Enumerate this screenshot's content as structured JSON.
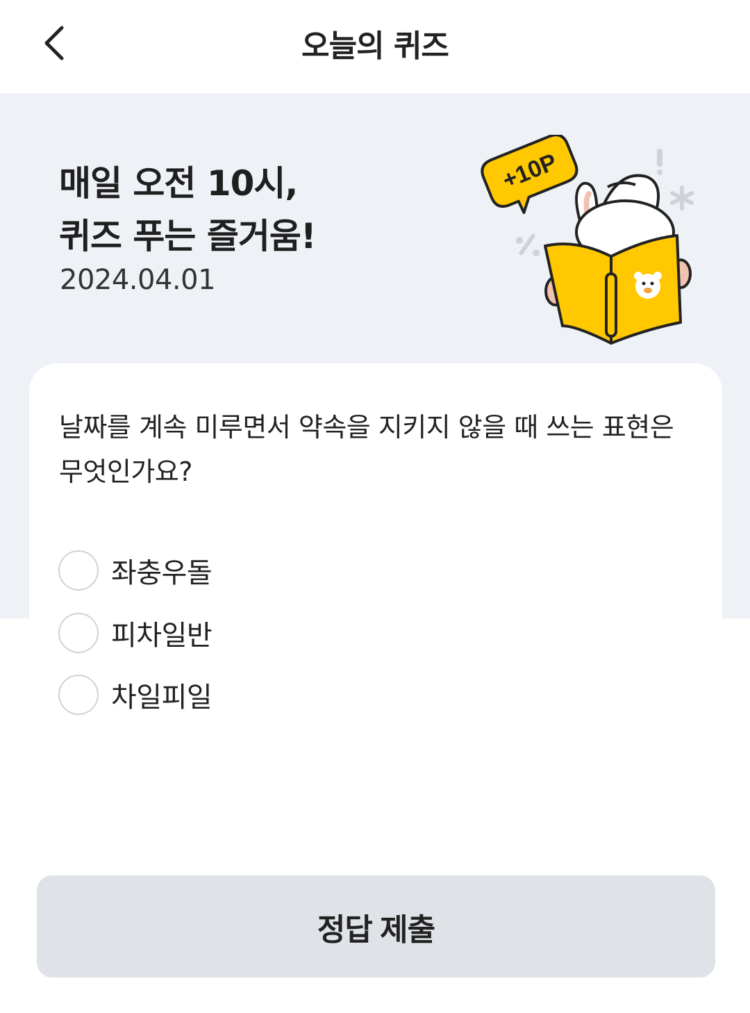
{
  "header": {
    "title": "오늘의 퀴즈",
    "back_icon": "chevron-left-icon"
  },
  "hero": {
    "headline_line1": "매일 오전 10시,",
    "headline_line2": "퀴즈 푸는 즐거움!",
    "date": "2024.04.01",
    "badge": "+10P",
    "accent_color": "#FFC800"
  },
  "quiz": {
    "question": "날짜를 계속 미루면서 약속을 지키지 않을 때 쓰는 표현은 무엇인가요?",
    "options": [
      {
        "label": "좌충우돌"
      },
      {
        "label": "피차일반"
      },
      {
        "label": "차일피일"
      }
    ]
  },
  "submit": {
    "label": "정답 제출"
  }
}
